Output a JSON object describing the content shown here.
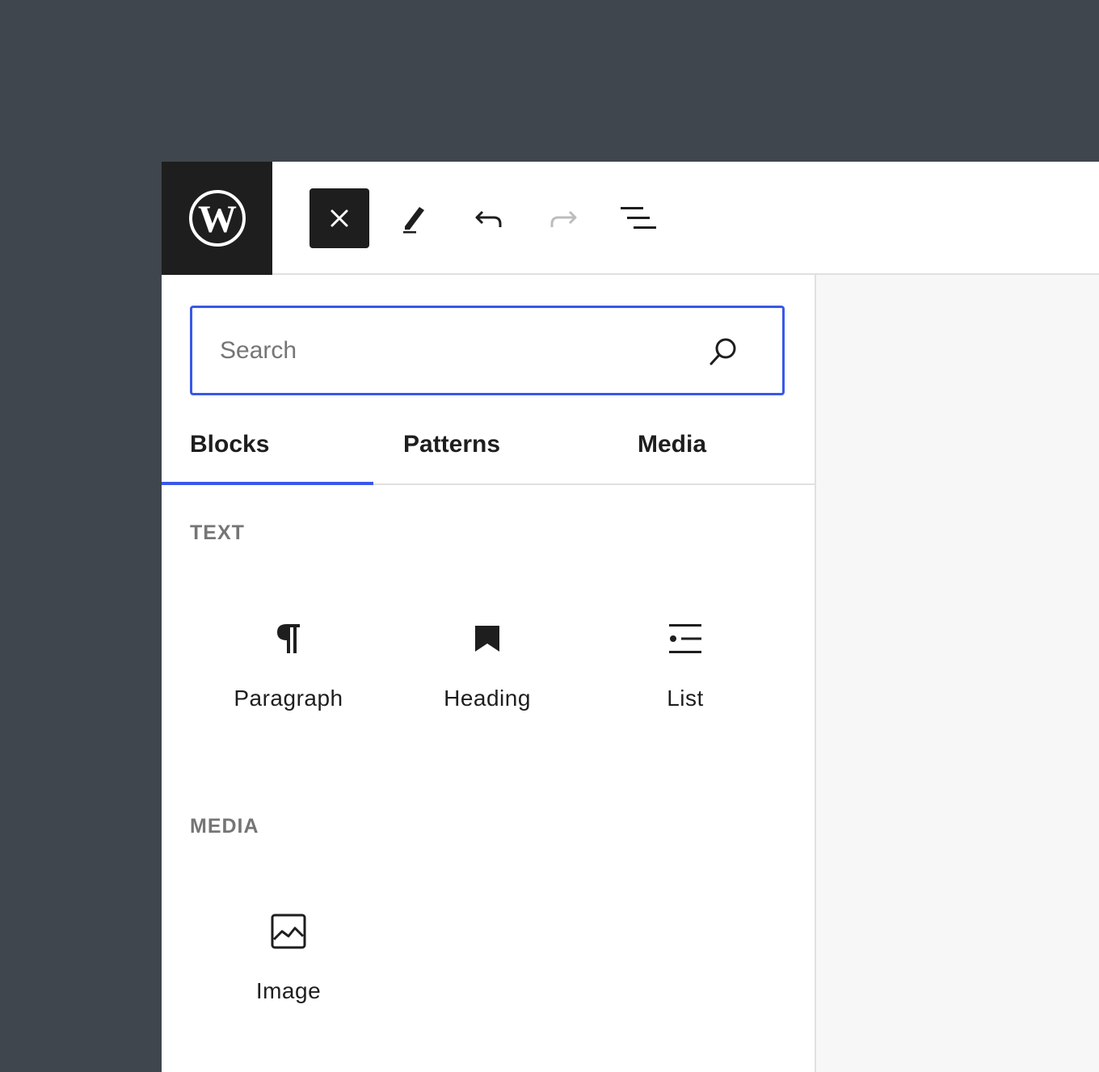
{
  "toolbar": {
    "logo_icon": "wordpress-logo-icon",
    "close_icon": "close-icon",
    "edit_icon": "pencil-icon",
    "undo_icon": "undo-icon",
    "redo_icon": "redo-icon",
    "outline_icon": "document-overview-icon"
  },
  "inserter": {
    "search": {
      "placeholder": "Search",
      "value": ""
    },
    "tabs": [
      {
        "label": "Blocks",
        "active": true
      },
      {
        "label": "Patterns",
        "active": false
      },
      {
        "label": "Media",
        "active": false
      }
    ],
    "sections": [
      {
        "title": "TEXT",
        "blocks": [
          {
            "label": "Paragraph",
            "icon": "paragraph-icon"
          },
          {
            "label": "Heading",
            "icon": "heading-bookmark-icon"
          },
          {
            "label": "List",
            "icon": "list-icon"
          }
        ]
      },
      {
        "title": "MEDIA",
        "blocks": [
          {
            "label": "Image",
            "icon": "image-icon"
          }
        ]
      }
    ]
  },
  "colors": {
    "accent": "#3858e9",
    "dark": "#1e1e1e",
    "background": "#3f464e",
    "muted": "#757575"
  }
}
